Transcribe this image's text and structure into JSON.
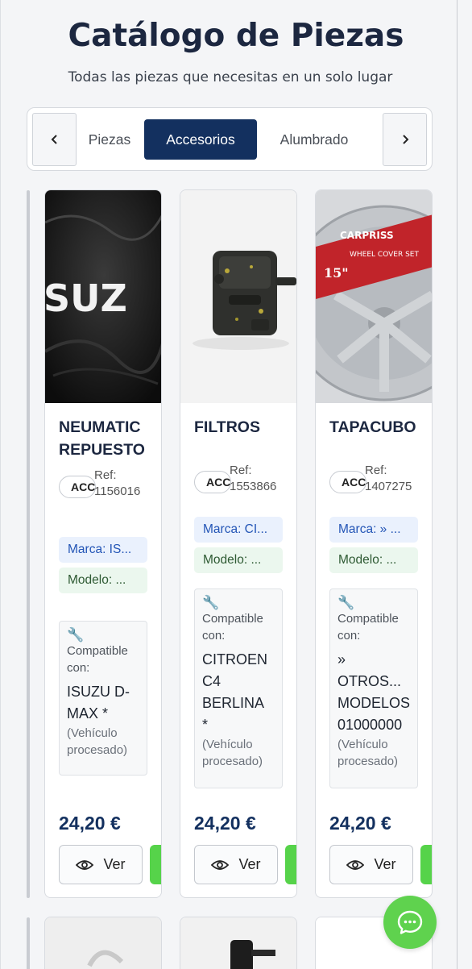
{
  "header": {
    "title": "Catálogo de Piezas",
    "subtitle": "Todas las piezas que necesitas en un solo lugar"
  },
  "tabs": {
    "items": [
      "Piezas",
      "Accesorios",
      "Alumbrado"
    ],
    "active": "Accesorios",
    "prev_icon": "chevron-left-icon",
    "next_icon": "chevron-right-icon"
  },
  "products": [
    {
      "name_line1": "NEUMATIC",
      "name_line2": "REPUESTO",
      "category": "ACC",
      "ref_label": "Ref:",
      "ref": "1156016",
      "marca": "Marca: IS...",
      "modelo": "Modelo: ...",
      "compat_label1": "Compatible",
      "compat_label2": "con:",
      "vehicle_lines": [
        "ISUZU D-",
        "MAX *"
      ],
      "proc1": "(Vehículo",
      "proc2": "procesado)",
      "price": "24,20 €",
      "view_label": "Ver"
    },
    {
      "name_line1": "FILTROS",
      "name_line2": "",
      "category": "ACC",
      "ref_label": "Ref:",
      "ref": "1553866",
      "marca": "Marca: CI...",
      "modelo": "Modelo: ...",
      "compat_label1": "Compatible",
      "compat_label2": "con:",
      "vehicle_lines": [
        "CITROEN",
        "C4",
        "BERLINA",
        "*"
      ],
      "proc1": "(Vehículo",
      "proc2": "procesado)",
      "price": "24,20 €",
      "view_label": "Ver"
    },
    {
      "name_line1": "TAPACUBO",
      "name_line2": "",
      "category": "ACC",
      "ref_label": "Ref:",
      "ref": "1407275",
      "marca": "Marca: » ...",
      "modelo": "Modelo: ...",
      "compat_label1": "Compatible",
      "compat_label2": "con:",
      "vehicle_lines": [
        "»",
        "OTROS...",
        "MODELOS",
        "01000000"
      ],
      "proc1": "(Vehículo",
      "proc2": "procesado)",
      "price": "24,20 €",
      "view_label": "Ver"
    }
  ],
  "images": {
    "isuzu_text": "SUZ",
    "hubcap_brand": "CARPRISS",
    "hubcap_size": "15\"",
    "hubcap_set": "WHEEL COVER SET"
  },
  "colors": {
    "primary": "#13305f",
    "accent_green": "#56d34a",
    "marca_bg": "#eaf1fd",
    "modelo_bg": "#ebf7ee"
  },
  "chat": {
    "icon": "chat-bubble-icon"
  }
}
